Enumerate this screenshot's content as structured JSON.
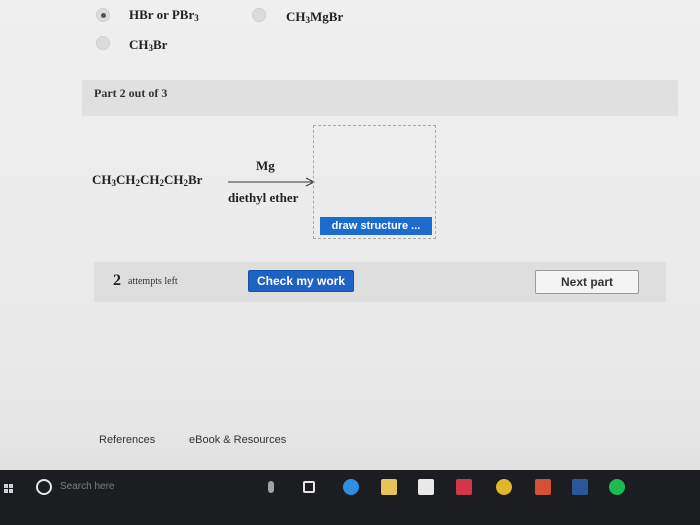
{
  "options": [
    {
      "id": "hbr",
      "parts": [
        {
          "t": "HBr or PBr"
        },
        {
          "s": "3"
        }
      ],
      "selected": true
    },
    {
      "id": "grignard",
      "parts": [
        {
          "t": "CH"
        },
        {
          "s": "3"
        },
        {
          "t": "MgBr"
        }
      ],
      "selected": false
    },
    {
      "id": "ch3br",
      "parts": [
        {
          "t": "CH"
        },
        {
          "s": "3"
        },
        {
          "t": "Br"
        }
      ],
      "selected": false
    }
  ],
  "part_bar": {
    "label": "Part 2 out of 3"
  },
  "reaction": {
    "reactant_parts": [
      {
        "t": "CH"
      },
      {
        "s": "3"
      },
      {
        "t": "CH"
      },
      {
        "s": "2"
      },
      {
        "t": "CH"
      },
      {
        "s": "2"
      },
      {
        "t": "CH"
      },
      {
        "s": "2"
      },
      {
        "t": "Br"
      }
    ],
    "reagent_above": "Mg",
    "reagent_below": "diethyl ether",
    "draw_button": "draw structure ..."
  },
  "attempts": {
    "count": "2",
    "label": "attempts left"
  },
  "buttons": {
    "check": "Check my work",
    "next": "Next part"
  },
  "footer": {
    "references": "References",
    "ebook": "eBook & Resources"
  },
  "taskbar": {
    "search_placeholder": "Search here",
    "icons": [
      {
        "name": "microphone-icon",
        "color": "#9ea3a8"
      },
      {
        "name": "task-view-icon",
        "color": "#e6e6e6"
      },
      {
        "name": "edge-browser-icon",
        "color": "#2d8fe0"
      },
      {
        "name": "file-explorer-icon",
        "color": "#e8c35a"
      },
      {
        "name": "store-icon",
        "color": "#e9e9e9"
      },
      {
        "name": "mail-icon",
        "color": "#d7364a"
      },
      {
        "name": "chrome-icon",
        "color": "#e2b629"
      },
      {
        "name": "powerpoint-icon",
        "color": "#d35230"
      },
      {
        "name": "word-icon",
        "color": "#2b579a"
      },
      {
        "name": "spotify-icon",
        "color": "#1db954"
      }
    ]
  }
}
